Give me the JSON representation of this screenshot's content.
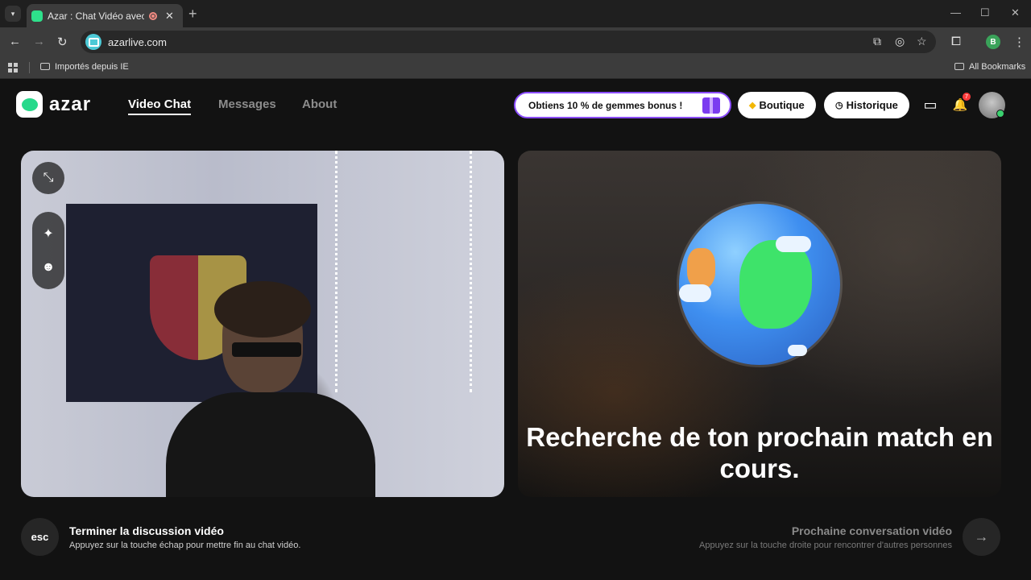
{
  "browser": {
    "tab_title": "Azar : Chat Vidéo avec de n",
    "tab_close": "✕",
    "new_tab": "+",
    "url": "azarlive.com",
    "profile_initial": "B",
    "bookmarks": {
      "imported": "Importés depuis IE",
      "all": "All Bookmarks"
    }
  },
  "header": {
    "logo_text": "azar",
    "nav": {
      "video_chat": "Video Chat",
      "messages": "Messages",
      "about": "About"
    },
    "promo_text": "Obtiens 10 % de gemmes bonus !",
    "shop_label": "Boutique",
    "history_label": "Historique",
    "notification_count": "7"
  },
  "main": {
    "search_text": "Recherche de ton prochain match en cours."
  },
  "footer": {
    "esc_key": "esc",
    "end_title": "Terminer la discussion vidéo",
    "end_subtitle": "Appuyez sur la touche échap pour mettre fin au chat vidéo.",
    "next_title": "Prochaine conversation vidéo",
    "next_subtitle": "Appuyez sur la touche droite pour rencontrer d'autres personnes"
  },
  "icons": {
    "back": "←",
    "forward": "→",
    "reload": "↻",
    "cast": "⧉",
    "eye_off": "◎",
    "star": "☆",
    "extensions": "⧠",
    "menu": "⋮",
    "minimize": "—",
    "maximize": "☐",
    "close": "✕",
    "shop": "◆",
    "history": "◷",
    "inbox": "▭",
    "bell": "🔔",
    "collapse": "⤡",
    "magic": "✦",
    "face": "☻",
    "arrow_right": "→"
  },
  "colors": {
    "accent_green": "#27d98b",
    "promo_border": "#8b4dff",
    "notification_red": "#ff3b3b"
  }
}
